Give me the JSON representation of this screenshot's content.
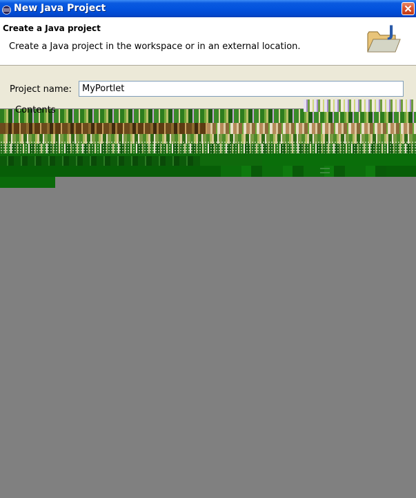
{
  "window": {
    "title": "New Java Project",
    "icon": "eclipse-icon"
  },
  "title_bar": {
    "close_icon": "close-icon"
  },
  "banner": {
    "title": "Create a Java project",
    "description": "Create a Java project in the workspace or in an external location.",
    "icon": "java-project-folder-icon"
  },
  "form": {
    "project_name_label": "Project name:",
    "project_name_value": "MyPortlet",
    "contents_label": "Contents"
  },
  "colors": {
    "title_bar": "#0353dd",
    "dialog_background": "#ece9d8",
    "banner_background": "#ffffff",
    "input_border": "#7f9db9",
    "desktop_background": "#808080",
    "close_button": "#d9532e"
  }
}
